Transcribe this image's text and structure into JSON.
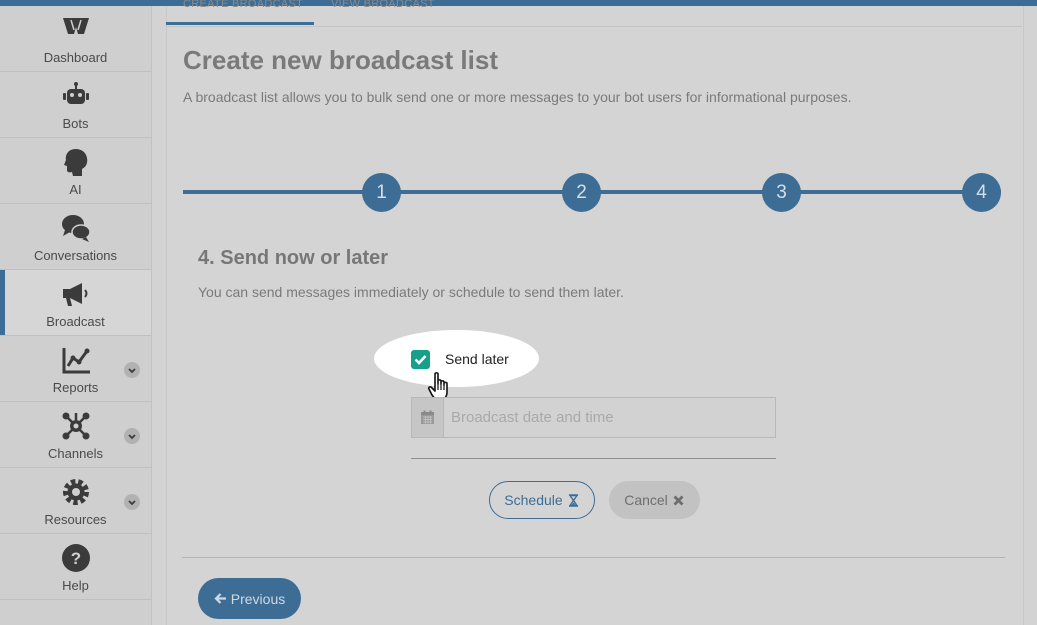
{
  "tabs": {
    "create": "CREATE BROADCAST",
    "view": "VIEW BROADCAST"
  },
  "sidebar": {
    "items": [
      {
        "label": "Dashboard",
        "icon": "dashboard-icon"
      },
      {
        "label": "Bots",
        "icon": "robot-icon"
      },
      {
        "label": "AI",
        "icon": "brain-head-icon"
      },
      {
        "label": "Conversations",
        "icon": "chat-bubbles-icon"
      },
      {
        "label": "Broadcast",
        "icon": "megaphone-icon",
        "active": true
      },
      {
        "label": "Reports",
        "icon": "line-chart-icon",
        "expandable": true
      },
      {
        "label": "Channels",
        "icon": "network-icon",
        "expandable": true
      },
      {
        "label": "Resources",
        "icon": "gear-icon",
        "expandable": true
      },
      {
        "label": "Help",
        "icon": "help-icon"
      }
    ]
  },
  "page": {
    "title": "Create new broadcast list",
    "subtitle": "A broadcast list allows you to bulk send one or more messages to your bot users for informational purposes."
  },
  "stepper": {
    "steps": [
      "1",
      "2",
      "3",
      "4"
    ],
    "current": 4
  },
  "section": {
    "title": "4. Send now or later",
    "subtitle": "You can send messages immediately or schedule to send them later."
  },
  "send_later": {
    "label": "Send later",
    "checked": true
  },
  "date_field": {
    "placeholder": "Broadcast date and time",
    "value": "",
    "icon": "calendar-icon"
  },
  "buttons": {
    "schedule": "Schedule",
    "schedule_icon": "hourglass-icon",
    "cancel": "Cancel",
    "cancel_icon": "close-icon",
    "previous": "Previous",
    "previous_icon": "arrow-left-icon"
  },
  "colors": {
    "primary": "#3d6d95",
    "checkbox": "#16a08c",
    "overlay_bg": "#d4d4d4"
  }
}
